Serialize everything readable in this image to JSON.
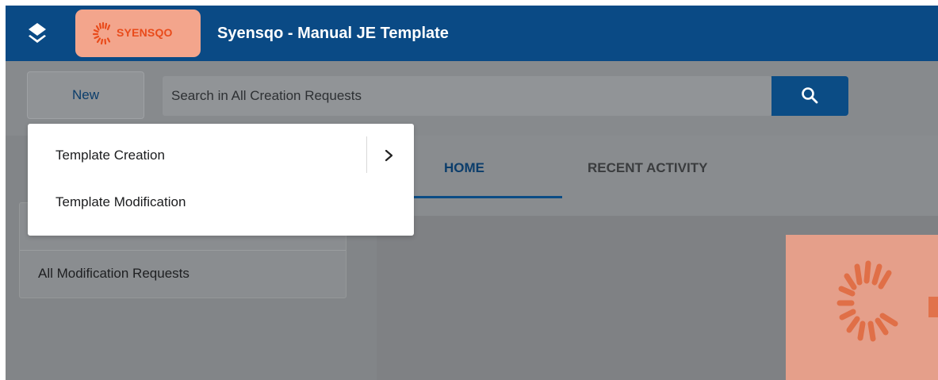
{
  "header": {
    "app_title": "Syensqo - Manual JE Template",
    "logo_text": "SYENSQO",
    "brand_color": "#0a4a85",
    "logo_bg_color": "#f3a58c",
    "logo_accent_color": "#e94b1b"
  },
  "toolbar": {
    "new_label": "New",
    "search_placeholder": "Search in All Creation Requests"
  },
  "dropdown": {
    "items": [
      {
        "label": "Template Creation",
        "has_submenu": true
      },
      {
        "label": "Template Modification",
        "has_submenu": false
      }
    ]
  },
  "sidebar": {
    "items": [
      {
        "label": ""
      },
      {
        "label": "All Modification Requests"
      }
    ]
  },
  "tabs": [
    {
      "label": "HOME",
      "active": true
    },
    {
      "label": "RECENT ACTIVITY",
      "active": false
    }
  ],
  "icons": {
    "app": "stack-icon",
    "search": "search-icon",
    "submenu": "chevron-right-icon"
  }
}
